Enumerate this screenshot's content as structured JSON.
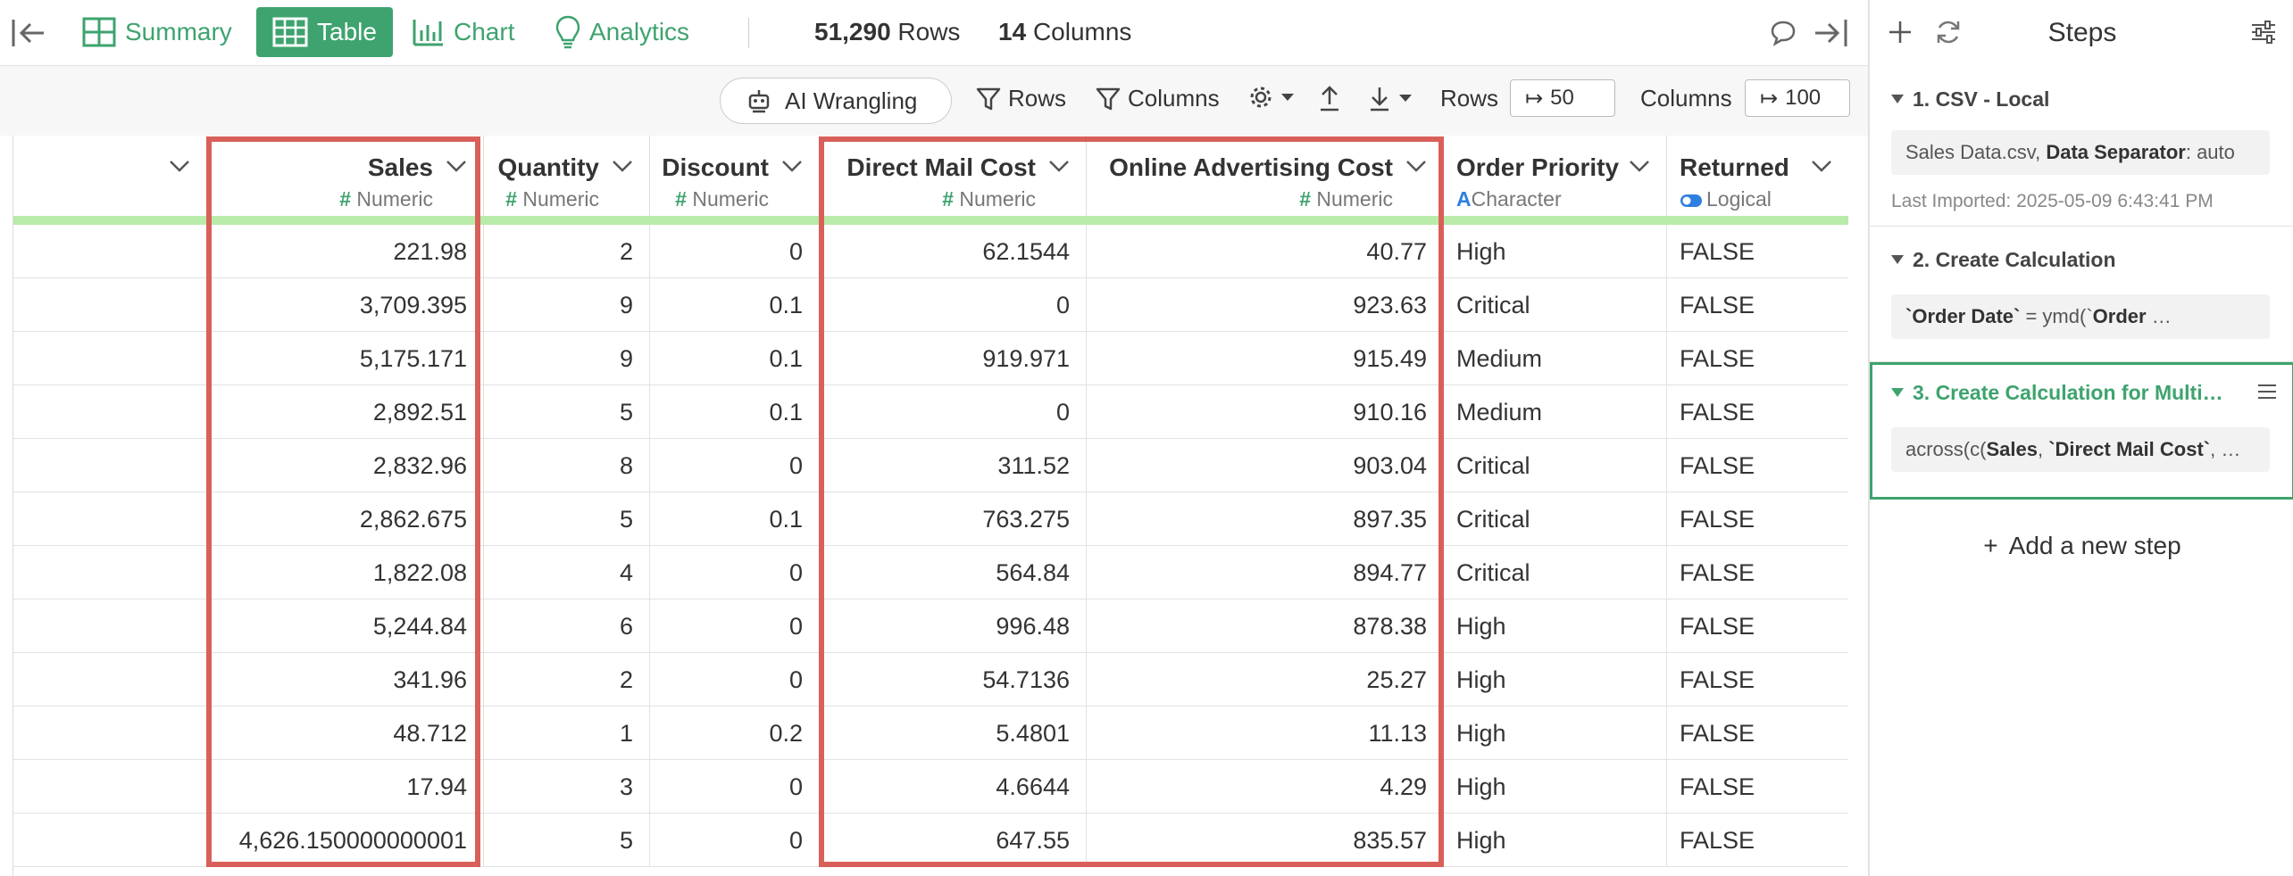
{
  "topbar": {
    "tabs": [
      {
        "label": "Summary",
        "icon": "grid-icon"
      },
      {
        "label": "Table",
        "icon": "table-icon",
        "active": true
      },
      {
        "label": "Chart",
        "icon": "bar-chart-icon"
      },
      {
        "label": "Analytics",
        "icon": "lightbulb-icon"
      }
    ],
    "rows_count": "51,290",
    "rows_label": "Rows",
    "cols_count": "14",
    "cols_label": "Columns"
  },
  "toolbar": {
    "ai_label": "AI Wrangling",
    "rows_filter": "Rows",
    "columns_filter": "Columns",
    "rows_label": "Rows",
    "rows_value": "50",
    "columns_label": "Columns",
    "columns_value": "100"
  },
  "columns": [
    {
      "name": "",
      "type": ""
    },
    {
      "name": "Sales",
      "type": "Numeric",
      "type_glyph": "#"
    },
    {
      "name": "Quantity",
      "type": "Numeric",
      "type_glyph": "#"
    },
    {
      "name": "Discount",
      "type": "Numeric",
      "type_glyph": "#"
    },
    {
      "name": "Direct Mail Cost",
      "type": "Numeric",
      "type_glyph": "#"
    },
    {
      "name": "Online Advertising Cost",
      "type": "Numeric",
      "type_glyph": "#"
    },
    {
      "name": "Order Priority",
      "type": "Character",
      "type_glyph": "A"
    },
    {
      "name": "Returned",
      "type": "Logical",
      "type_glyph": "toggle"
    }
  ],
  "rows": [
    [
      "",
      "221.98",
      "2",
      "0",
      "62.1544",
      "40.77",
      "High",
      "FALSE"
    ],
    [
      "",
      "3,709.395",
      "9",
      "0.1",
      "0",
      "923.63",
      "Critical",
      "FALSE"
    ],
    [
      "",
      "5,175.171",
      "9",
      "0.1",
      "919.971",
      "915.49",
      "Medium",
      "FALSE"
    ],
    [
      "",
      "2,892.51",
      "5",
      "0.1",
      "0",
      "910.16",
      "Medium",
      "FALSE"
    ],
    [
      "",
      "2,832.96",
      "8",
      "0",
      "311.52",
      "903.04",
      "Critical",
      "FALSE"
    ],
    [
      "",
      "2,862.675",
      "5",
      "0.1",
      "763.275",
      "897.35",
      "Critical",
      "FALSE"
    ],
    [
      "",
      "1,822.08",
      "4",
      "0",
      "564.84",
      "894.77",
      "Critical",
      "FALSE"
    ],
    [
      "",
      "5,244.84",
      "6",
      "0",
      "996.48",
      "878.38",
      "High",
      "FALSE"
    ],
    [
      "",
      "341.96",
      "2",
      "0",
      "54.7136",
      "25.27",
      "High",
      "FALSE"
    ],
    [
      "",
      "48.712",
      "1",
      "0.2",
      "5.4801",
      "11.13",
      "High",
      "FALSE"
    ],
    [
      "",
      "17.94",
      "3",
      "0",
      "4.6644",
      "4.29",
      "High",
      "FALSE"
    ],
    [
      "",
      "4,626.150000000001",
      "5",
      "0",
      "647.55",
      "835.57",
      "High",
      "FALSE"
    ]
  ],
  "panel": {
    "title": "Steps",
    "steps": [
      {
        "title": "1. CSV - Local",
        "detail_plain": "Sales Data.csv, ",
        "detail_bold": "Data Separator",
        "detail_rest": ": auto",
        "sub": "Last Imported: 2025-05-09 6:43:41 PM"
      },
      {
        "title": "2. Create Calculation",
        "detail_bold": "`Order Date`",
        "detail_plain": " = ymd(`",
        "detail_bold2": "Order",
        "detail_rest": " …"
      },
      {
        "title": "3. Create Calculation for Multi…",
        "detail_plain": "across(c(",
        "detail_bold": "Sales",
        "detail_mid": ", ",
        "detail_bold2": "`Direct Mail Cost`",
        "detail_rest": ", …"
      }
    ],
    "add_label": "Add a new step"
  },
  "colors": {
    "accent": "#3ea36e",
    "highlight": "#d9605a",
    "type_bar": "#b9ebaa",
    "character_type": "#2f7fe0"
  }
}
